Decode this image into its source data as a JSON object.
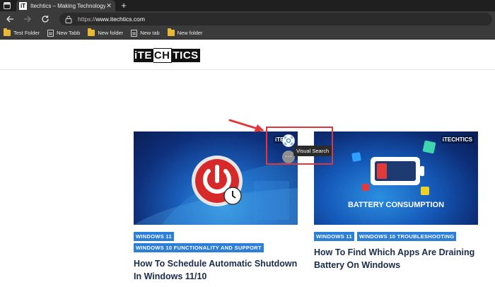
{
  "browser": {
    "tab": {
      "favicon_text": "iT",
      "title": "Itechtics – Making Technology A",
      "close_symbol": "✕"
    },
    "new_tab_symbol": "+",
    "address": {
      "prefix": "https://",
      "host": "www.itechtics.com"
    },
    "bookmarks": [
      {
        "label": "Test Folder",
        "icon": "folder-icon"
      },
      {
        "label": "New Tabb",
        "icon": "page-icon"
      },
      {
        "label": "New folder",
        "icon": "folder-icon"
      },
      {
        "label": "New tab",
        "icon": "page-icon"
      },
      {
        "label": "New folder",
        "icon": "folder-icon"
      }
    ]
  },
  "site": {
    "logo": {
      "part1": "iTE",
      "part2": "CH",
      "part3": "TICS"
    },
    "posts": [
      {
        "thumb_mark": "iTECH",
        "tags": [
          "WINDOWS 11",
          "WINDOWS 10 FUNCTIONALITY AND SUPPORT"
        ],
        "title": "How To Schedule Automatic Shutdown In Windows 11/10"
      },
      {
        "thumb_mark": "iTECHTICS",
        "thumb_caption": "BATTERY CONSUMPTION",
        "tags": [
          "WINDOWS 11",
          "WINDOWS 10 TROUBLESHOOTING"
        ],
        "title": "How To Find Which Apps Are Draining Battery On Windows"
      }
    ]
  },
  "overlay": {
    "tooltip": "Visual Search",
    "more_symbol": "···"
  },
  "colors": {
    "tag_bg": "#2d7ed6",
    "title_text": "#1b2b49",
    "annotation_red": "#e0383a",
    "chrome_dark": "#1f1f1f",
    "chrome_mid": "#3b3b3b"
  }
}
